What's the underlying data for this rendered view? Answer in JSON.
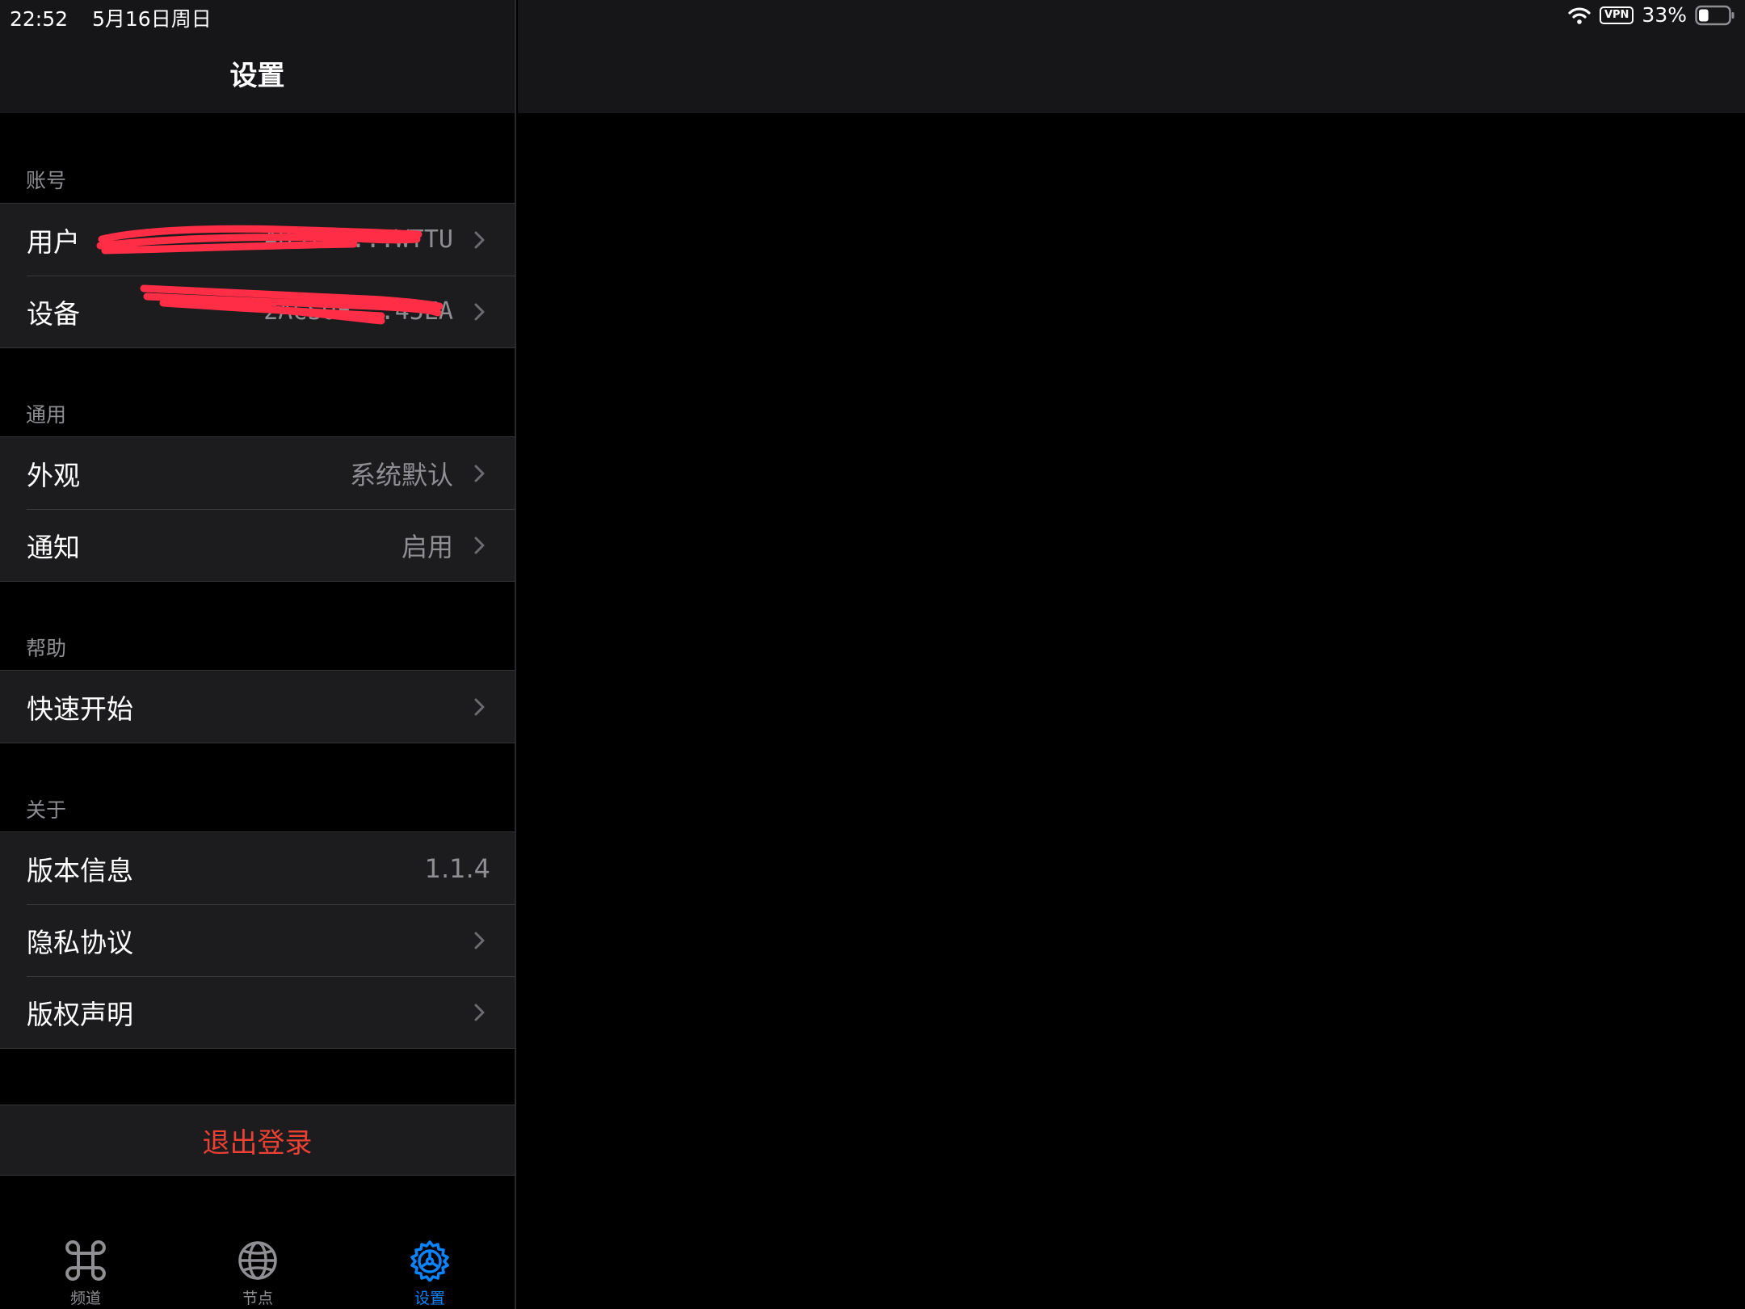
{
  "status_bar": {
    "time": "22:52",
    "date": "5月16日周日",
    "vpn": "VPN",
    "battery": "33%",
    "battery_level": 0.33
  },
  "nav": {
    "title": "设置"
  },
  "sections": {
    "account": {
      "header": "账号",
      "user_label": "用户",
      "user_value": "ADSTM6...WTTU",
      "device_label": "设备",
      "device_value": "2ACSOF...45EA"
    },
    "general": {
      "header": "通用",
      "appearance_label": "外观",
      "appearance_value": "系统默认",
      "notify_label": "通知",
      "notify_value": "启用"
    },
    "help": {
      "header": "帮助",
      "quickstart_label": "快速开始"
    },
    "about": {
      "header": "关于",
      "version_label": "版本信息",
      "version_value": "1.1.4",
      "privacy_label": "隐私协议",
      "copyright_label": "版权声明"
    }
  },
  "logout": {
    "label": "退出登录"
  },
  "tabs": {
    "channels": "频道",
    "nodes": "节点",
    "settings": "设置",
    "active": "settings"
  },
  "colors": {
    "accent": "#0a84ff",
    "destructive": "#eb4034",
    "redaction": "#ff2d45"
  }
}
